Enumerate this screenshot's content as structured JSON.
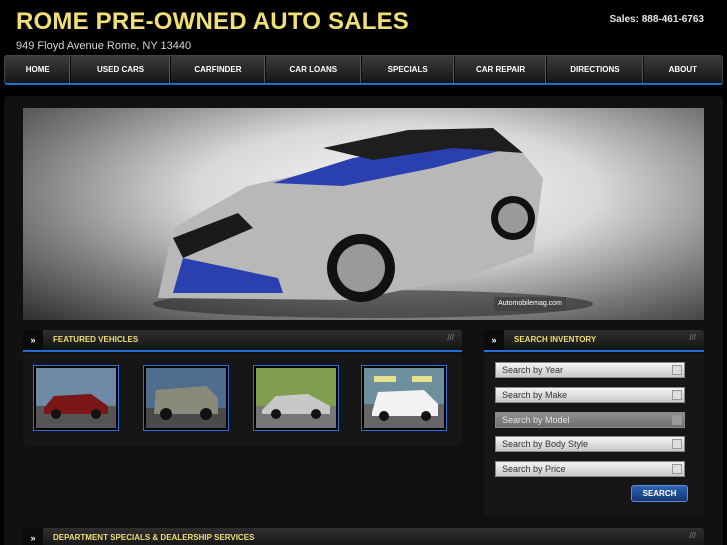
{
  "header": {
    "title": "ROME PRE-OWNED AUTO SALES",
    "address": "949 Floyd Avenue  Rome,  NY  13440",
    "phone": "Sales: 888-461-6763"
  },
  "nav": [
    "HOME",
    "USED CARS",
    "CARFINDER",
    "CAR LOANS",
    "SPECIALS",
    "CAR REPAIR",
    "DIRECTIONS",
    "ABOUT"
  ],
  "hero": {
    "credit": "Automobilemag.com"
  },
  "featured": {
    "arrow": "»",
    "title": "FEATURED VEHICLES",
    "slash": "///",
    "vehicles": [
      {
        "icon": "red-sedan-photo",
        "color": "#7a1616"
      },
      {
        "icon": "silver-suv-photo",
        "color": "#8a8a7a"
      },
      {
        "icon": "silver-sedan-photo",
        "color": "#c8c8c8"
      },
      {
        "icon": "white-sedan-photo",
        "color": "#f2f2f2"
      }
    ]
  },
  "search": {
    "arrow": "»",
    "title": "SEARCH INVENTORY",
    "slash": "///",
    "year": "Search by Year",
    "make": "Search by Make",
    "model": "Search by Model",
    "body": "Search by Body Style",
    "price": "Search by Price",
    "button": "SEARCH"
  },
  "specials": {
    "arrow": "»",
    "title": "DEPARTMENT SPECIALS & DEALERSHIP SERVICES",
    "slash": "///"
  }
}
